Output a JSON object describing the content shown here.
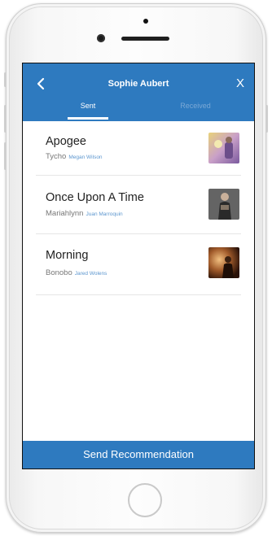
{
  "header": {
    "title": "Sophie Aubert",
    "back_icon": "chevron-left-icon",
    "close_label": "X"
  },
  "tabs": [
    {
      "label": "Sent",
      "active": true
    },
    {
      "label": "Received",
      "active": false
    }
  ],
  "recommendations": [
    {
      "title": "Apogee",
      "artist": "Tycho",
      "recommended_by": "Megan Wilson"
    },
    {
      "title": "Once Upon A Time",
      "artist": "Mariahlynn",
      "recommended_by": "Juan Marroquin"
    },
    {
      "title": "Morning",
      "artist": "Bonobo",
      "recommended_by": "Jared Wolens"
    }
  ],
  "footer": {
    "label": "Send Recommendation"
  },
  "colors": {
    "accent": "#2e7abf",
    "link": "#5d97cf"
  }
}
